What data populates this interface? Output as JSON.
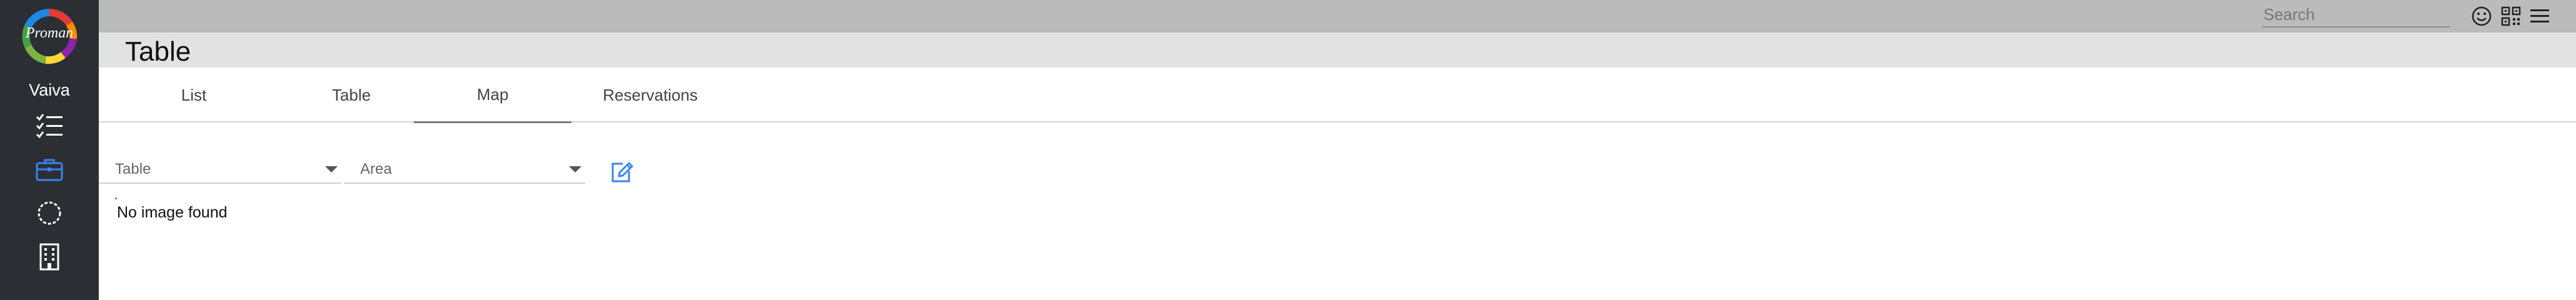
{
  "app": {
    "logo_text": "Proman",
    "workspace_name": "Vaiva"
  },
  "sidebar": {
    "items": [
      {
        "name": "checklist-icon"
      },
      {
        "name": "briefcase-icon",
        "active": true
      },
      {
        "name": "circle-dashed-icon"
      },
      {
        "name": "building-icon"
      }
    ],
    "active_color": "#3b82f6"
  },
  "topbar": {
    "search_placeholder": "Search",
    "icons": [
      "smiley-icon",
      "qr-code-icon",
      "hamburger-menu-icon"
    ]
  },
  "page": {
    "title": "Table"
  },
  "tabs": [
    {
      "label": "List",
      "active": false
    },
    {
      "label": "Table",
      "active": false
    },
    {
      "label": "Map",
      "active": true
    },
    {
      "label": "Reservations",
      "active": false
    }
  ],
  "filters": {
    "table_placeholder": "Table",
    "area_placeholder": "Area"
  },
  "content": {
    "no_image_text": "No image found"
  },
  "colors": {
    "sidebar_bg": "#2b2f33",
    "topbar_bg": "#bbbbbb",
    "titlebar_bg": "#e2e2e2",
    "accent": "#3b82f6"
  }
}
